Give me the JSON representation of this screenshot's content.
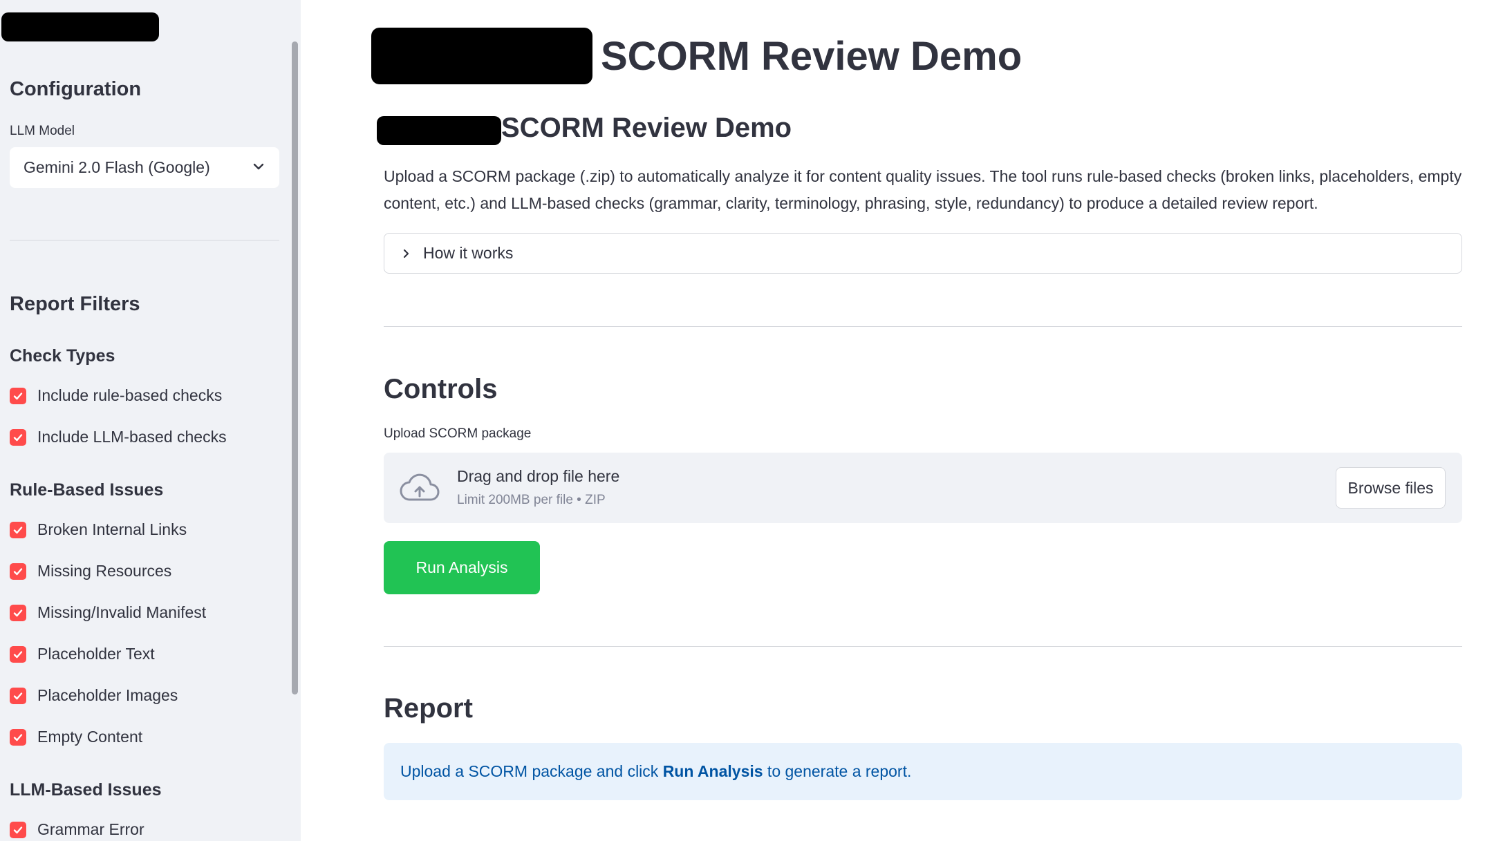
{
  "sidebar": {
    "config_title": "Configuration",
    "llm_model_label": "LLM Model",
    "llm_model_value": "Gemini 2.0 Flash (Google)",
    "report_filters_title": "Report Filters",
    "check_types_title": "Check Types",
    "check_types": [
      {
        "label": "Include rule-based checks",
        "checked": true
      },
      {
        "label": "Include LLM-based checks",
        "checked": true
      }
    ],
    "rule_based_title": "Rule-Based Issues",
    "rule_based": [
      {
        "label": "Broken Internal Links",
        "checked": true
      },
      {
        "label": "Missing Resources",
        "checked": true
      },
      {
        "label": "Missing/Invalid Manifest",
        "checked": true
      },
      {
        "label": "Placeholder Text",
        "checked": true
      },
      {
        "label": "Placeholder Images",
        "checked": true
      },
      {
        "label": "Empty Content",
        "checked": true
      }
    ],
    "llm_based_title": "LLM-Based Issues",
    "llm_based": [
      {
        "label": "Grammar Error",
        "checked": true
      }
    ]
  },
  "main": {
    "title": "SCORM Review Demo",
    "subtitle": "SCORM Review Demo",
    "intro": "Upload a SCORM package (.zip) to automatically analyze it for content quality issues. The tool runs rule-based checks (broken links, placeholders, empty content, etc.) and LLM-based checks (grammar, clarity, terminology, phrasing, style, redundancy) to produce a detailed review report.",
    "expander_label": "How it works",
    "controls_title": "Controls",
    "upload_label": "Upload SCORM package",
    "dropzone_title": "Drag and drop file here",
    "dropzone_limit": "Limit 200MB per file • ZIP",
    "browse_label": "Browse files",
    "run_label": "Run Analysis",
    "report_title": "Report",
    "report_info_pre": "Upload a SCORM package and click ",
    "report_info_bold": "Run Analysis",
    "report_info_post": " to generate a report."
  },
  "colors": {
    "accent_checkbox": "#ff4b4b",
    "run_button": "#21c354",
    "info_bg": "#e8f2fc",
    "info_text": "#0054a3",
    "sidebar_bg": "#f0f2f6"
  },
  "icons": [
    "chevron-down-icon",
    "chevron-right-icon",
    "check-icon",
    "cloud-upload-icon"
  ]
}
